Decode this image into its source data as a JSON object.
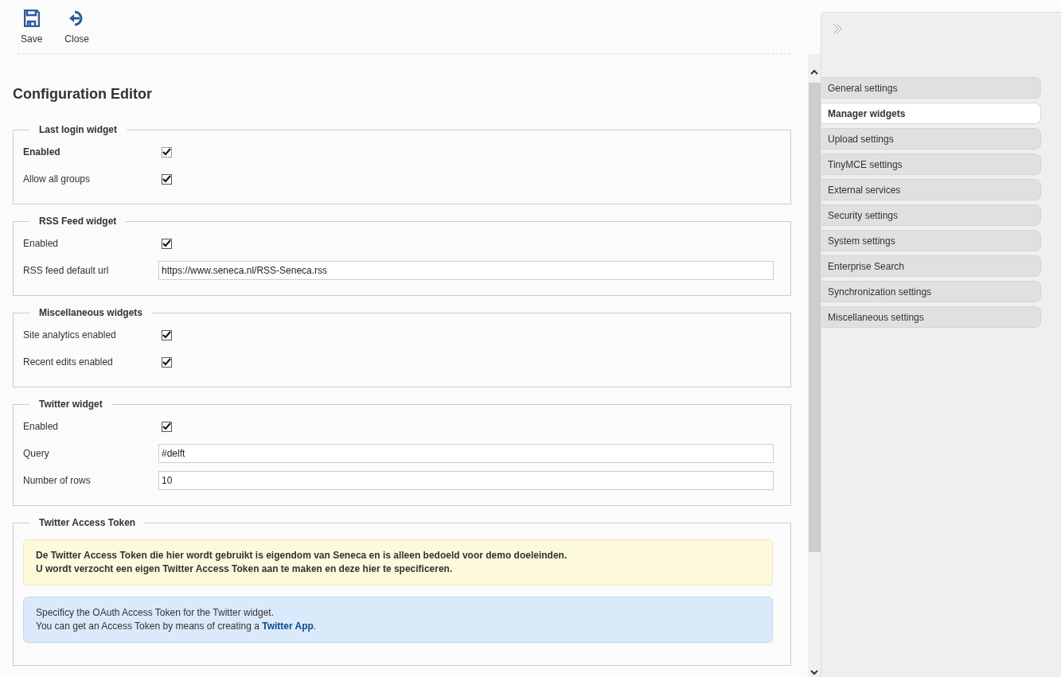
{
  "toolbar": [
    {
      "kind": "save",
      "label": "Save"
    },
    {
      "kind": "close",
      "label": "Close"
    }
  ],
  "title": "Configuration Editor",
  "sections": [
    {
      "legend": "Last login widget",
      "fields": [
        {
          "kind": "checkbox",
          "label": "Enabled",
          "checked": true,
          "focused": true
        },
        {
          "kind": "checkbox",
          "label": "Allow all groups",
          "checked": true,
          "focused": false
        }
      ]
    },
    {
      "legend": "RSS Feed widget",
      "fields": [
        {
          "kind": "checkbox",
          "label": "Enabled",
          "checked": true,
          "focused": false
        },
        {
          "kind": "text",
          "label": "RSS feed default url",
          "value": "https://www.seneca.nl/RSS-Seneca.rss",
          "focused": false
        }
      ]
    },
    {
      "legend": "Miscellaneous widgets",
      "fields": [
        {
          "kind": "checkbox",
          "label": "Site analytics enabled",
          "checked": true,
          "focused": false
        },
        {
          "kind": "checkbox",
          "label": "Recent edits enabled",
          "checked": true,
          "focused": false
        }
      ]
    },
    {
      "legend": "Twitter widget",
      "fields": [
        {
          "kind": "checkbox",
          "label": "Enabled",
          "checked": true,
          "focused": false
        },
        {
          "kind": "text",
          "label": "Query",
          "value": "#delft",
          "focused": false
        },
        {
          "kind": "text",
          "label": "Number of rows",
          "value": "10",
          "focused": false
        }
      ]
    },
    {
      "legend": "Twitter Access Token",
      "notices": [
        {
          "kind": "warning",
          "lines": [
            {
              "text": "De Twitter Access Token die hier wordt gebruikt is eigendom van Seneca en is alleen bedoeld voor demo doeleinden."
            },
            {
              "text": "U wordt verzocht een eigen Twitter Access Token aan te maken en deze hier te specificeren."
            }
          ]
        },
        {
          "kind": "info",
          "lines": [
            {
              "text": "Specificy the OAuth Access Token for the Twitter widget."
            },
            {
              "text": "You can get an Access Token by means of creating a ",
              "link": "Twitter App",
              "after": "."
            }
          ]
        }
      ]
    }
  ],
  "sidebar": {
    "items": [
      {
        "label": "General settings",
        "selected": false
      },
      {
        "label": "Manager widgets",
        "selected": true
      },
      {
        "label": "Upload settings",
        "selected": false
      },
      {
        "label": "TinyMCE settings",
        "selected": false
      },
      {
        "label": "External services",
        "selected": false
      },
      {
        "label": "Security settings",
        "selected": false
      },
      {
        "label": "System settings",
        "selected": false
      },
      {
        "label": "Enterprise Search",
        "selected": false
      },
      {
        "label": "Synchronization settings",
        "selected": false
      },
      {
        "label": "Miscellaneous settings",
        "selected": false
      }
    ]
  }
}
